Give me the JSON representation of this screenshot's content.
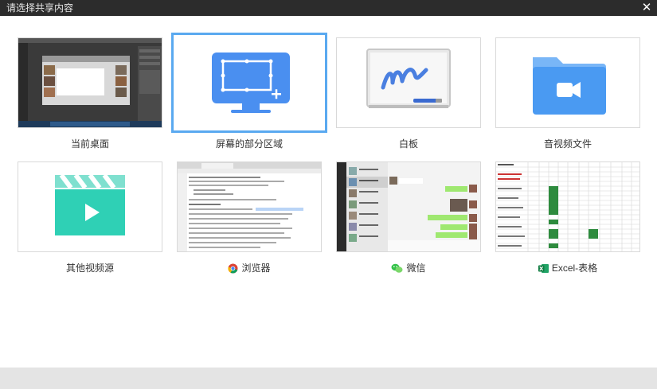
{
  "dialog": {
    "title": "请选择共享内容",
    "close_glyph": "✕"
  },
  "options": [
    {
      "id": "desktop",
      "label": "当前桌面",
      "icon": "desktop-thumbnail"
    },
    {
      "id": "region",
      "label": "屏幕的部分区域",
      "icon": "screen-region-icon",
      "selected": true
    },
    {
      "id": "whiteboard",
      "label": "白板",
      "icon": "whiteboard-icon"
    },
    {
      "id": "av-file",
      "label": "音视频文件",
      "icon": "video-folder-icon"
    },
    {
      "id": "other-video",
      "label": "其他视频源",
      "icon": "clapperboard-icon"
    },
    {
      "id": "browser",
      "label": "浏览器",
      "icon": "chrome-icon"
    },
    {
      "id": "wechat",
      "label": "微信",
      "icon": "wechat-icon"
    },
    {
      "id": "excel",
      "label": "Excel-表格",
      "icon": "excel-icon"
    }
  ],
  "colors": {
    "titlebar": "#2c2c2c",
    "accent_blue": "#4a8ff0",
    "selected_border": "#5aa9f0",
    "teal": "#2fd0b5",
    "excel_green": "#1f7a45"
  }
}
